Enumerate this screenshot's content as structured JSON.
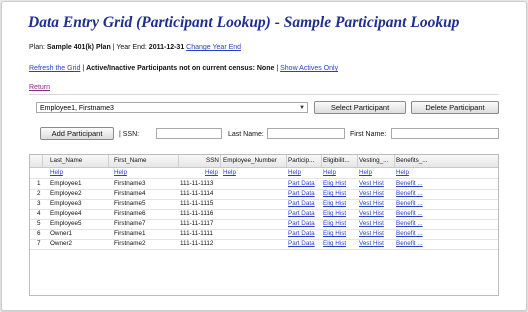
{
  "title": "Data Entry Grid (Participant Lookup) - Sample Participant Lookup",
  "plan": {
    "label": "Plan:",
    "name": "Sample 401(k) Plan",
    "sep": "|",
    "year_end_label": "Year End:",
    "year_end_value": "2011-12-31",
    "change_link": "Change Year End"
  },
  "refresh": {
    "link": "Refresh the Grid",
    "sep": "|",
    "status": "Active/Inactive Participants not on current census: None",
    "sep2": "|",
    "show_link": "Show Actives Only"
  },
  "return_link": "Return",
  "select": {
    "value": "Employee1, Firstname3"
  },
  "buttons": {
    "select": "Select Participant",
    "delete": "Delete Participant",
    "add": "Add Participant"
  },
  "filters": {
    "ssn": "| SSN:",
    "last": "Last Name:",
    "first": "First Name:"
  },
  "grid": {
    "headers": [
      "Last_Name",
      "First_Name",
      "SSN",
      "Employee_Number",
      "Particip...",
      "Eligibilit...",
      "Vesting_...",
      "Benefits_..."
    ],
    "help_label": "Help",
    "rows": [
      {
        "num": "1",
        "last": "Employee1",
        "first": "Firstname3",
        "ssn": "111-11-1113",
        "part": "Part Data",
        "elig": "Elig Hist",
        "vest": "Vest Hist",
        "ben": "Benefit ..."
      },
      {
        "num": "2",
        "last": "Employee2",
        "first": "Firstname4",
        "ssn": "111-11-1114",
        "part": "Part Data",
        "elig": "Elig Hist",
        "vest": "Vest Hist",
        "ben": "Benefit ..."
      },
      {
        "num": "3",
        "last": "Employee3",
        "first": "Firstname5",
        "ssn": "111-11-1115",
        "part": "Part Data",
        "elig": "Elig Hist",
        "vest": "Vest Hist",
        "ben": "Benefit ..."
      },
      {
        "num": "4",
        "last": "Employee4",
        "first": "Firstname6",
        "ssn": "111-11-1116",
        "part": "Part Data",
        "elig": "Elig Hist",
        "vest": "Vest Hist",
        "ben": "Benefit ..."
      },
      {
        "num": "5",
        "last": "Employee5",
        "first": "Firstname7",
        "ssn": "111-11-1117",
        "part": "Part Data",
        "elig": "Elig Hist",
        "vest": "Vest Hist",
        "ben": "Benefit ..."
      },
      {
        "num": "6",
        "last": "Owner1",
        "first": "Firstname1",
        "ssn": "111-11-1111",
        "part": "Part Data",
        "elig": "Elig Hist",
        "vest": "Vest Hist",
        "ben": "Benefit ..."
      },
      {
        "num": "7",
        "last": "Owner2",
        "first": "Firstname2",
        "ssn": "111-11-1112",
        "part": "Part Data",
        "elig": "Elig Hist",
        "vest": "Vest Hist",
        "ben": "Benefit ..."
      }
    ]
  }
}
